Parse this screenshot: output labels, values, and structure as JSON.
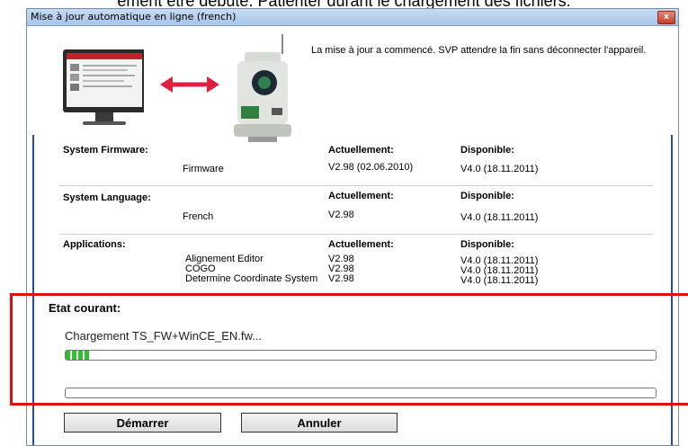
{
  "header_text": "ement être débuté. Patienter durant le chargement des fichiers.",
  "window": {
    "title": "Mise à jour automatique en ligne (french)",
    "close_glyph": "x"
  },
  "status_message": "La mise à jour a commencé. SVP attendre la fin sans déconnecter l'appareil.",
  "sections": {
    "firmware": {
      "heading": "System Firmware:",
      "item": "Firmware",
      "current_label": "Actuellement:",
      "current": "V2.98 (02.06.2010)",
      "available_label": "Disponible:",
      "available": "V4.0 (18.11.2011)"
    },
    "language": {
      "heading": "System Language:",
      "item": "French",
      "current_label": "Actuellement:",
      "current": "V2.98",
      "available_label": "Disponible:",
      "available": "V4.0 (18.11.2011)"
    },
    "applications": {
      "heading": "Applications:",
      "current_label": "Actuellement:",
      "available_label": "Disponible:",
      "items": [
        {
          "name": "Alignement Editor",
          "current": "V2.98",
          "available": "V4.0 (18.11.2011)"
        },
        {
          "name": "COGO",
          "current": "V2.98",
          "available": "V4.0 (18.11.2011)"
        },
        {
          "name": "Determine Coordinate System",
          "current": "V2.98",
          "available": "V4.0 (18.11.2011)"
        }
      ]
    }
  },
  "current_state": {
    "label": "Etat courant:",
    "loading_text": "Chargement  TS_FW+WinCE_EN.fw...",
    "progress1": 0.04,
    "progress2": 0.0
  },
  "buttons": {
    "start": "Démarrer",
    "cancel": "Annuler"
  },
  "colors": {
    "highlight": "#e0100d",
    "progress": "#2fbf2f",
    "arrow": "#e02040"
  }
}
